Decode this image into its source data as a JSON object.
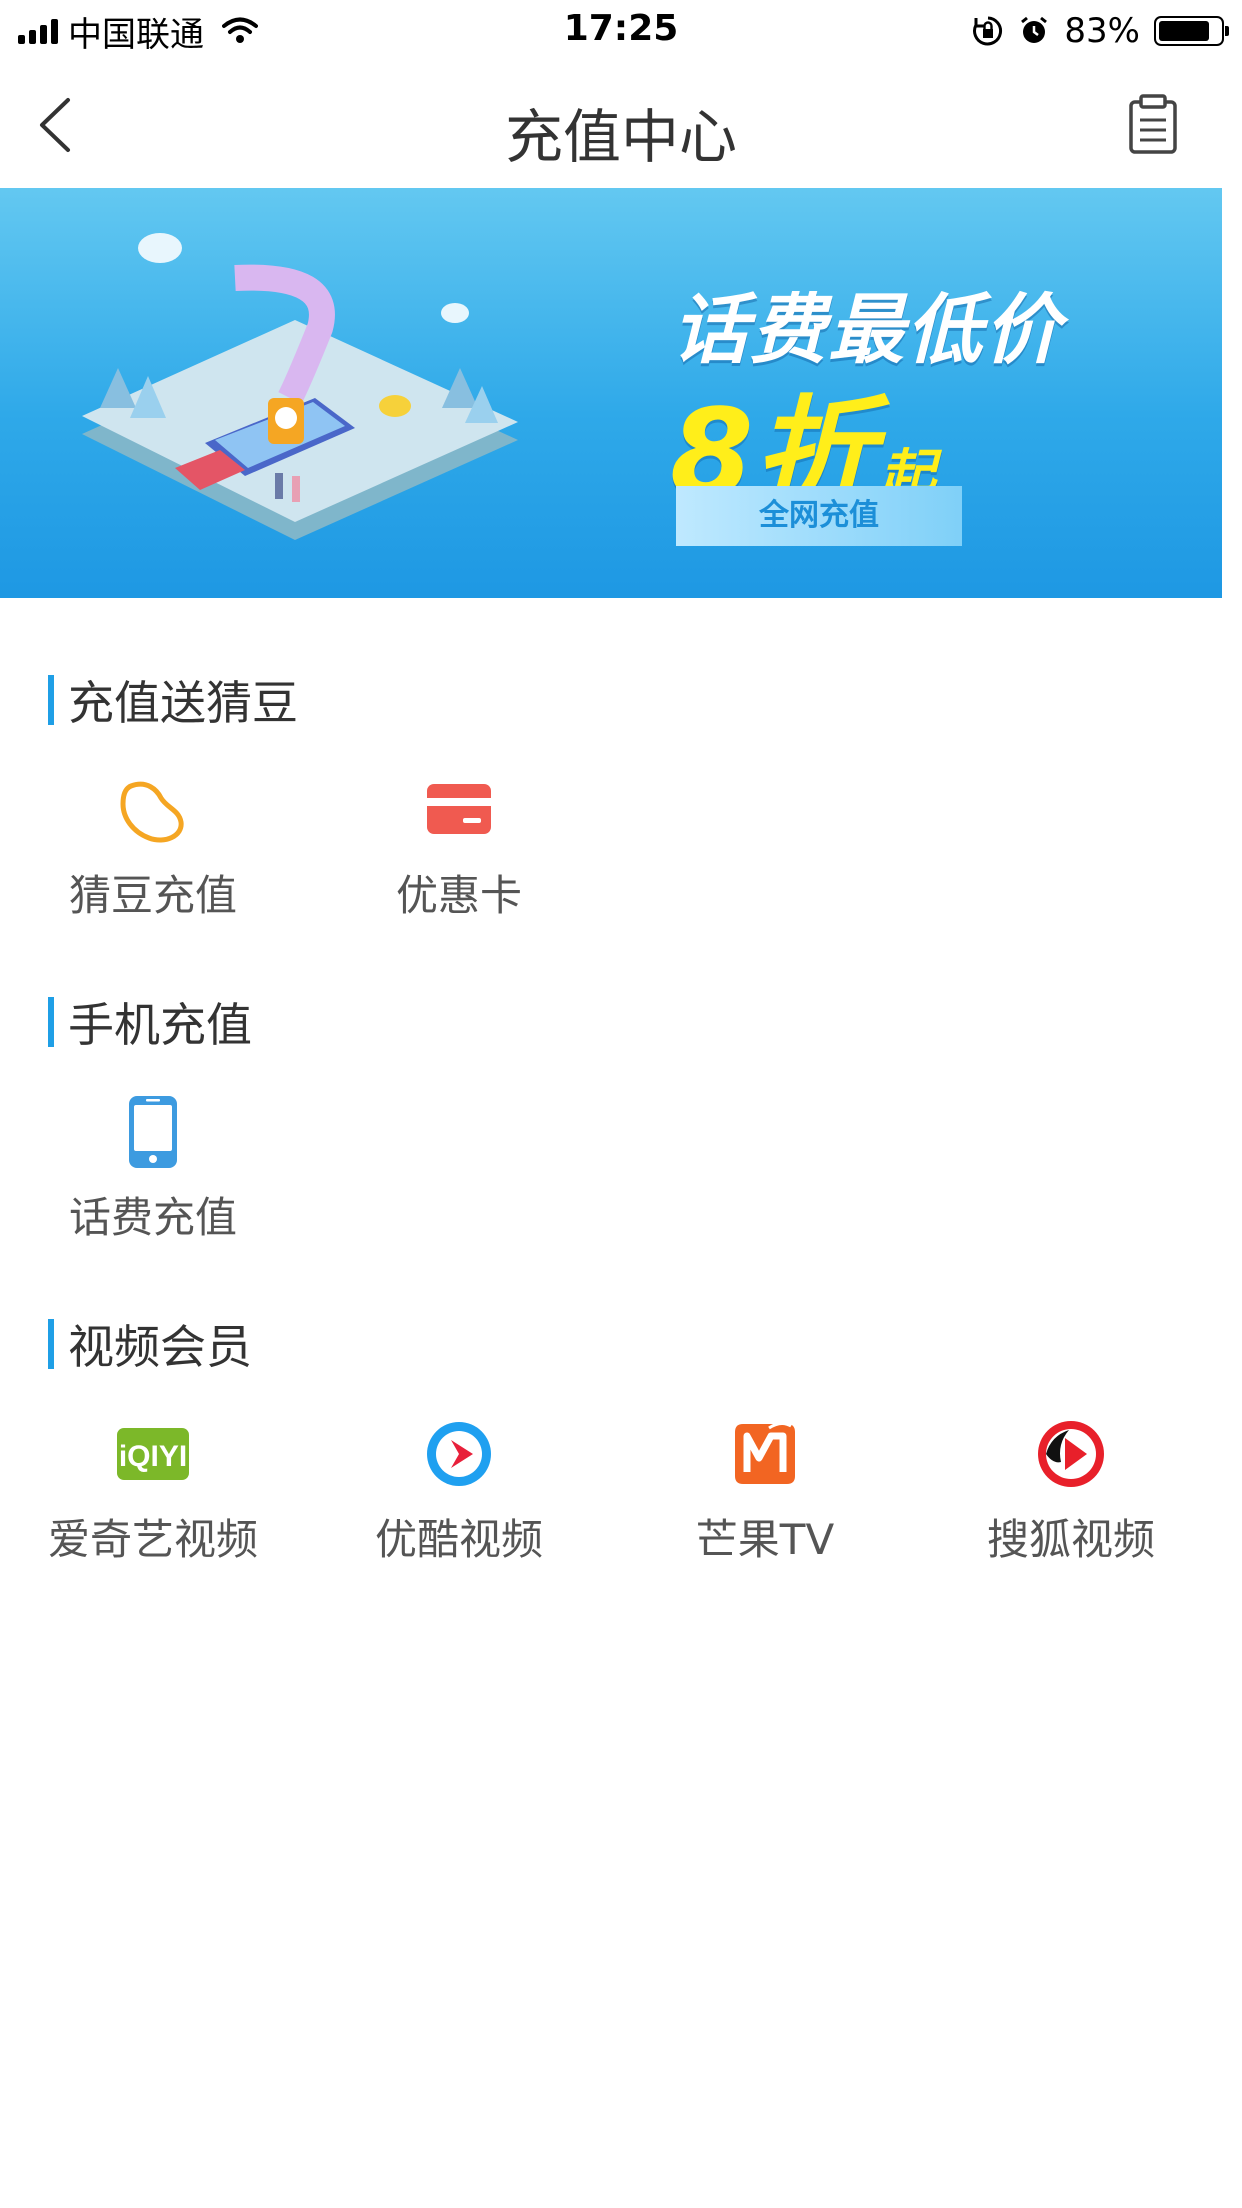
{
  "status_bar": {
    "carrier": "中国联通",
    "time": "17:25",
    "battery_percent": "83%",
    "battery_level": 0.83
  },
  "nav": {
    "title": "充值中心",
    "back_icon": "chevron-left-icon",
    "record_icon": "clipboard-icon"
  },
  "banner": {
    "title": "话费最低价",
    "discount_value": "8折",
    "discount_suffix": "起",
    "button_label": "全网充值"
  },
  "sections": [
    {
      "title": "充值送猜豆",
      "items": [
        {
          "label": "猜豆充值",
          "icon": "bean-icon"
        },
        {
          "label": "优惠卡",
          "icon": "card-icon"
        }
      ]
    },
    {
      "title": "手机充值",
      "items": [
        {
          "label": "话费充值",
          "icon": "phone-icon"
        }
      ]
    },
    {
      "title": "视频会员",
      "items": [
        {
          "label": "爱奇艺视频",
          "icon": "iqiyi-icon"
        },
        {
          "label": "优酷视频",
          "icon": "youku-icon"
        },
        {
          "label": "芒果TV",
          "icon": "mango-tv-icon"
        },
        {
          "label": "搜狐视频",
          "icon": "sohu-video-icon"
        }
      ]
    }
  ],
  "colors": {
    "accent": "#1f9fe6",
    "bean": "#f5a623",
    "card": "#f05a50",
    "phone": "#3d9be0",
    "iqiyi": "#7cb829",
    "youku": "#1fa0f0",
    "mango": "#f26522",
    "sohu": "#e8202a"
  }
}
